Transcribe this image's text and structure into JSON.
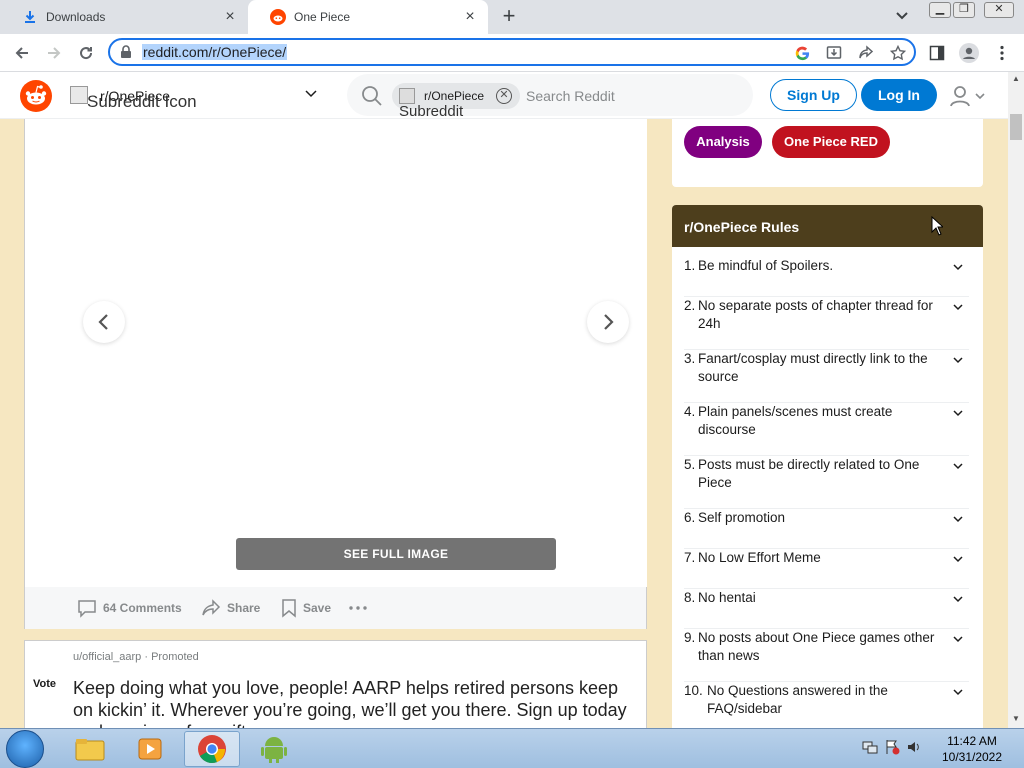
{
  "browser": {
    "tabs": [
      {
        "title": "Downloads",
        "active": false
      },
      {
        "title": "One Piece",
        "active": true
      }
    ],
    "url": "reddit.com/r/OnePiece/"
  },
  "header": {
    "community": "r/OnePiece",
    "community_icon_alt": "Subreddit Icon",
    "search_chip": "r/OnePiece",
    "search_chip_icon_alt": "Subreddit Icon",
    "search_placeholder": "Search Reddit",
    "signup_label": "Sign Up",
    "login_label": "Log In"
  },
  "post": {
    "see_full_image": "SEE FULL IMAGE",
    "comments": "64 Comments",
    "share": "Share",
    "save": "Save"
  },
  "promo": {
    "vote": "Vote",
    "author": "u/official_aarp",
    "promoted": "· Promoted",
    "headline": "Keep doing what you love, people! AARP helps retired persons keep on kickin’ it. Wherever you’re going, we’ll get you there. Sign up today and receive a free gift."
  },
  "sidebar": {
    "flairs": [
      {
        "label": "Analysis",
        "color": "#800080"
      },
      {
        "label": "One Piece RED",
        "color": "#c1121f"
      }
    ],
    "rules_title": "r/OnePiece Rules",
    "rules": [
      {
        "num": "1.",
        "text": "Be mindful of Spoilers."
      },
      {
        "num": "2.",
        "text": "No separate posts of chapter thread for 24h"
      },
      {
        "num": "3.",
        "text": "Fanart/cosplay must directly link to the source"
      },
      {
        "num": "4.",
        "text": "Plain panels/scenes must create discourse"
      },
      {
        "num": "5.",
        "text": "Posts must be directly related to One Piece"
      },
      {
        "num": "6.",
        "text": "Self promotion"
      },
      {
        "num": "7.",
        "text": "No Low Effort Meme"
      },
      {
        "num": "8.",
        "text": "No hentai"
      },
      {
        "num": "9.",
        "text": "No posts about One Piece games other than news"
      },
      {
        "num": "10.",
        "text": "No Questions answered in the FAQ/sidebar"
      }
    ]
  },
  "taskbar": {
    "time": "11:42 AM",
    "date": "10/31/2022"
  },
  "colors": {
    "reddit_orange": "#ff4500",
    "reddit_blue": "#0079d3",
    "page_bg": "#f6e7c1",
    "rules_header": "#4d3e1c"
  }
}
